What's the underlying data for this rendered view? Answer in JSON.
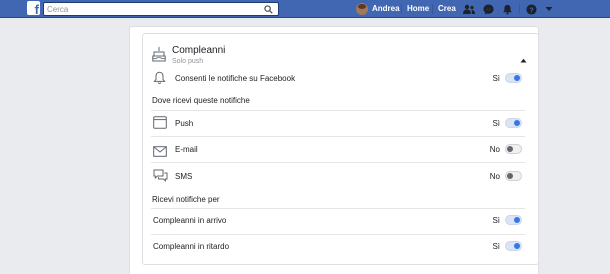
{
  "topbar": {
    "logo": "f",
    "search_placeholder": "Cerca",
    "user_name": "Andrea",
    "home_label": "Home",
    "create_label": "Crea",
    "icons": [
      "friends-icon",
      "messenger-icon",
      "notifications-icon",
      "help-icon",
      "account-menu-caret-icon"
    ]
  },
  "section": {
    "title": "Compleanni",
    "subtitle": "Solo push",
    "icon": "birthday-cake-icon",
    "collapse_icon": "caret-up-icon"
  },
  "allow": {
    "label": "Consenti le notifiche su Facebook",
    "value": "Sì",
    "enabled": true
  },
  "where_heading": "Dove ricevi queste notifiche",
  "channels": [
    {
      "name": "push",
      "label": "Push",
      "value": "Sì",
      "enabled": true,
      "icon": "browser-window-icon"
    },
    {
      "name": "email",
      "label": "E-mail",
      "value": "No",
      "enabled": false,
      "icon": "envelope-icon"
    },
    {
      "name": "sms",
      "label": "SMS",
      "value": "No",
      "enabled": false,
      "icon": "chat-bubbles-icon"
    }
  ],
  "receive_heading": "Ricevi notifiche per",
  "types": [
    {
      "name": "upcoming",
      "label": "Compleanni in arrivo",
      "value": "Sì",
      "enabled": true
    },
    {
      "name": "belated",
      "label": "Compleanni in ritardo",
      "value": "Sì",
      "enabled": true
    }
  ],
  "colors": {
    "topbar": "#4267b2",
    "toggle_on": "#3578e5",
    "toggle_off": "#606770",
    "page_bg": "#e9ebee"
  }
}
